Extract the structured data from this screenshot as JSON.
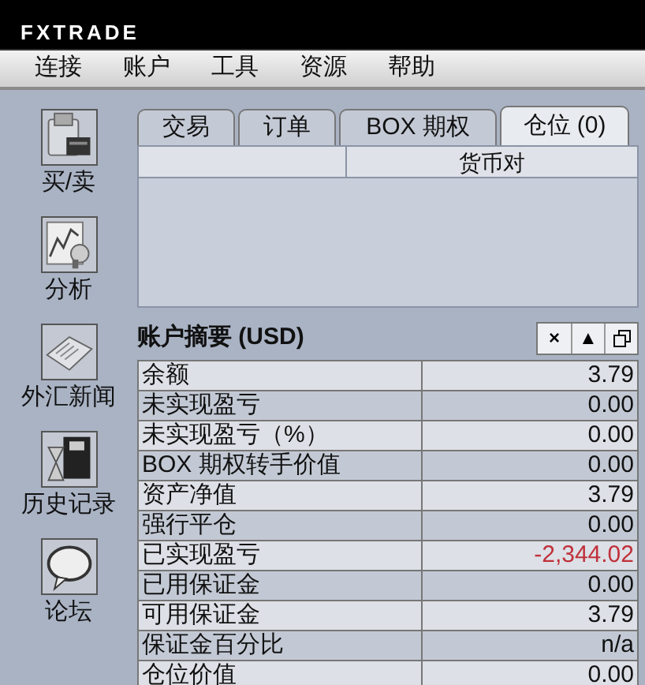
{
  "app": {
    "logo": "FXTRADE"
  },
  "menu": [
    "连接",
    "账户",
    "工具",
    "资源",
    "帮助"
  ],
  "sidebar": {
    "items": [
      {
        "label": "买/卖",
        "kind": "printer"
      },
      {
        "label": "分析",
        "kind": "chart"
      },
      {
        "label": "外汇新闻",
        "kind": "newspaper"
      },
      {
        "label": "历史记录",
        "kind": "history"
      },
      {
        "label": "论坛",
        "kind": "forum"
      }
    ]
  },
  "tabs": [
    {
      "label": "交易",
      "selected": false
    },
    {
      "label": "订单",
      "selected": false
    },
    {
      "label": "BOX 期权",
      "selected": false
    },
    {
      "label": "仓位 (0)",
      "selected": true
    }
  ],
  "positions_table": {
    "columns": [
      "货币对"
    ]
  },
  "summary": {
    "title": "账户摘要 (USD)",
    "controls": [
      {
        "kind": "close",
        "label": "×"
      },
      {
        "kind": "collapse",
        "label": "▲"
      },
      {
        "kind": "restore"
      }
    ],
    "rows": [
      {
        "label": "余额",
        "value": "3.79",
        "negative": false
      },
      {
        "label": "未实现盈亏",
        "value": "0.00",
        "negative": false
      },
      {
        "label": "未实现盈亏（%）",
        "value": "0.00",
        "negative": false
      },
      {
        "label": "BOX 期权转手价值",
        "value": "0.00",
        "negative": false
      },
      {
        "label": "资产净值",
        "value": "3.79",
        "negative": false
      },
      {
        "label": "强行平仓",
        "value": "0.00",
        "negative": false
      },
      {
        "label": "已实现盈亏",
        "value": "-2,344.02",
        "negative": true
      },
      {
        "label": "已用保证金",
        "value": "0.00",
        "negative": false
      },
      {
        "label": "可用保证金",
        "value": "3.79",
        "negative": false
      },
      {
        "label": "保证金百分比",
        "value": "n/a",
        "negative": false
      },
      {
        "label": "仓位价值",
        "value": "0.00",
        "negative": false
      }
    ]
  }
}
